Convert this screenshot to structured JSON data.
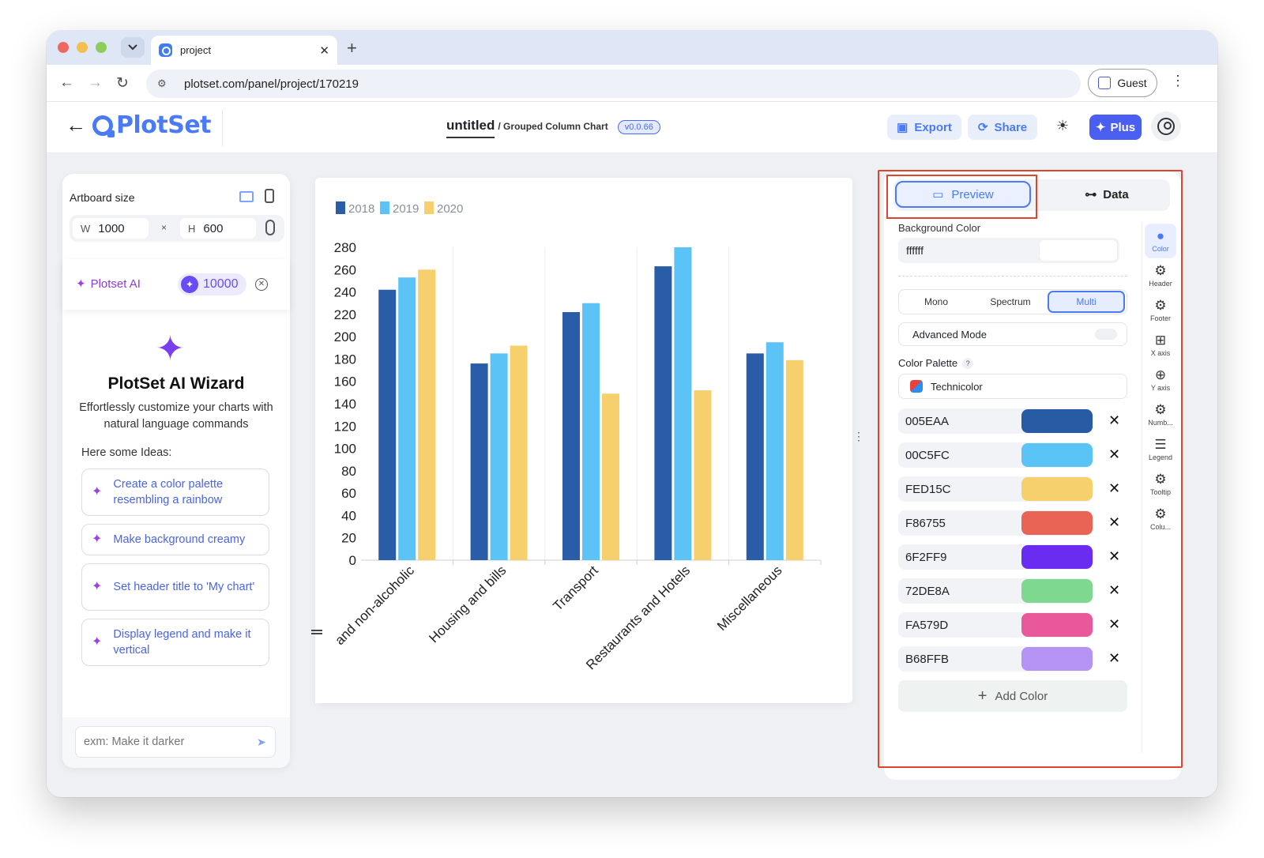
{
  "browser": {
    "tab_title": "project",
    "tab_close": "✕",
    "new_tab": "+",
    "url": "plotset.com/panel/project/170219",
    "profile": "Guest"
  },
  "header": {
    "logo": "PlotSet",
    "project_name": "untitled",
    "chart_type": "/ Grouped Column Chart",
    "version": "v0.0.66",
    "export_label": "Export",
    "share_label": "Share",
    "plus_label": "Plus"
  },
  "left_panel": {
    "artboard_title": "Artboard size",
    "width_label": "W",
    "width_value": "1000",
    "height_label": "H",
    "height_value": "600",
    "times": "×",
    "ai_label": "Plotset AI",
    "credits": "10000",
    "wizard_title": "PlotSet AI Wizard",
    "wizard_desc": "Effortlessly customize your charts with natural language commands",
    "ideas_title": "Here some Ideas:",
    "ideas": [
      "Create a color palette resembling a rainbow",
      "Make background creamy",
      "Set header title to 'My chart'",
      "Display legend and make it vertical"
    ],
    "chat_placeholder": "exm: Make it darker"
  },
  "chart_data": {
    "type": "bar",
    "categories": [
      "and non-alcoholic",
      "Housing and bills",
      "Transport",
      "Restaurants and Hotels",
      "Miscellaneous"
    ],
    "series": [
      {
        "name": "2018",
        "values": [
          242,
          176,
          222,
          263,
          185
        ],
        "color": "#2a5da8"
      },
      {
        "name": "2019",
        "values": [
          253,
          185,
          230,
          280,
          195
        ],
        "color": "#5bc3f5"
      },
      {
        "name": "2020",
        "values": [
          260,
          192,
          149,
          152,
          179
        ],
        "color": "#f6d06d"
      }
    ],
    "y_ticks": [
      "280",
      "260",
      "240",
      "220",
      "200",
      "180",
      "160",
      "140",
      "120",
      "100",
      "80",
      "60",
      "40",
      "20",
      "0"
    ],
    "ylim": [
      0,
      280
    ],
    "legend_position": "top-left",
    "title": "",
    "xlabel": "",
    "ylabel": ""
  },
  "right_panel": {
    "preview_label": "Preview",
    "data_label": "Data",
    "bg_color_label": "Background Color",
    "bg_color_value": "ffffff",
    "bg_color": "#ffffff",
    "modes": [
      "Mono",
      "Spectrum",
      "Multi"
    ],
    "advanced_mode_label": "Advanced Mode",
    "palette_label": "Color Palette",
    "palette_help": "?",
    "palette_value": "Technicolor",
    "colors": [
      {
        "hex": "005EAA",
        "swatch": "#275ca5"
      },
      {
        "hex": "00C5FC",
        "swatch": "#5bc4f7"
      },
      {
        "hex": "FED15C",
        "swatch": "#f6d06c"
      },
      {
        "hex": "F86755",
        "swatch": "#e96455"
      },
      {
        "hex": "6F2FF9",
        "swatch": "#6a2cf1"
      },
      {
        "hex": "72DE8A",
        "swatch": "#7fd88f"
      },
      {
        "hex": "FA579D",
        "swatch": "#e9589a"
      },
      {
        "hex": "B68FFB",
        "swatch": "#b593f4"
      }
    ],
    "remove_symbol": "✕",
    "add_color_label": "Add Color",
    "rail": [
      {
        "label": "Color",
        "icon": "palette-icon"
      },
      {
        "label": "Header",
        "icon": "gear-icon"
      },
      {
        "label": "Footer",
        "icon": "gear-icon"
      },
      {
        "label": "X axis",
        "icon": "grid-icon"
      },
      {
        "label": "Y axis",
        "icon": "globe-grid-icon"
      },
      {
        "label": "Numb...",
        "icon": "gear-icon"
      },
      {
        "label": "Legend",
        "icon": "legend-icon"
      },
      {
        "label": "Tooltip",
        "icon": "gear-icon"
      },
      {
        "label": "Colu...",
        "icon": "gear-icon"
      }
    ]
  }
}
